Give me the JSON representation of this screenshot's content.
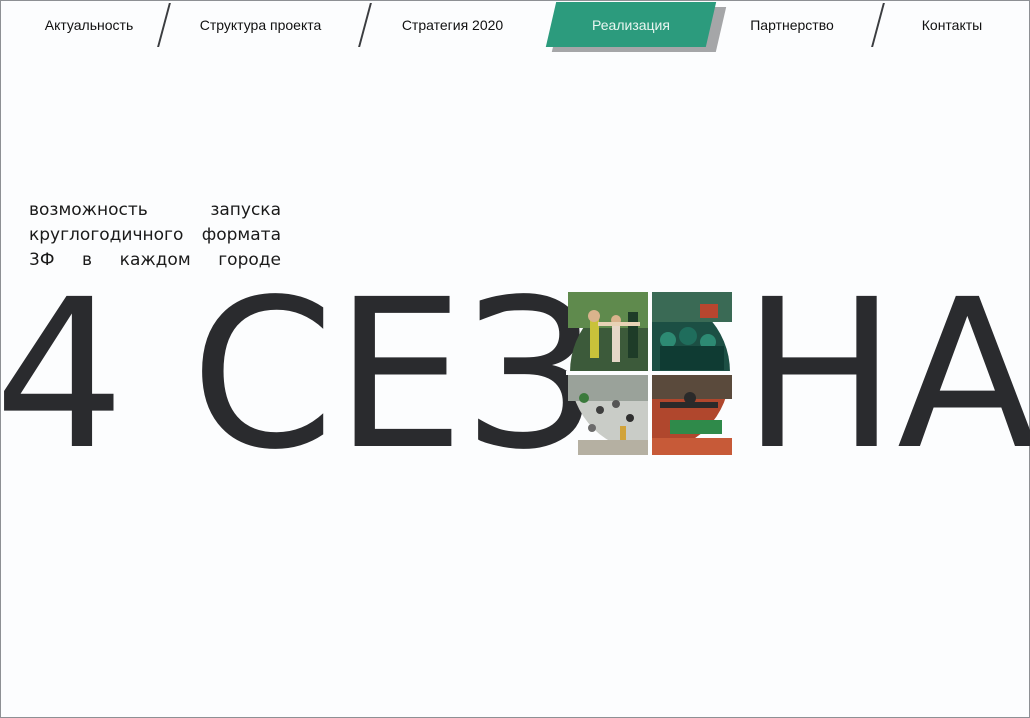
{
  "nav": {
    "items": [
      {
        "label": "Актуальность",
        "active": false
      },
      {
        "label": "Структура проекта",
        "active": false
      },
      {
        "label": "Стратегия 2020",
        "active": false
      },
      {
        "label": "Реализация",
        "active": true
      },
      {
        "label": "Партнерство",
        "active": false
      },
      {
        "label": "Контакты",
        "active": false
      }
    ]
  },
  "tagline": {
    "lines": [
      "возможность запуска",
      "круглогодичного формата",
      "3Ф в каждом городе"
    ]
  },
  "hero": {
    "title_left": "4 СЕЗ",
    "title_right": "НА",
    "collage_quadrants": [
      "summer-photo",
      "autumn-photo",
      "winter-photo",
      "spring-photo"
    ]
  },
  "colors": {
    "accent": "#2c9b7d",
    "text": "#2a2b2e",
    "background": "#fcfdfe"
  }
}
